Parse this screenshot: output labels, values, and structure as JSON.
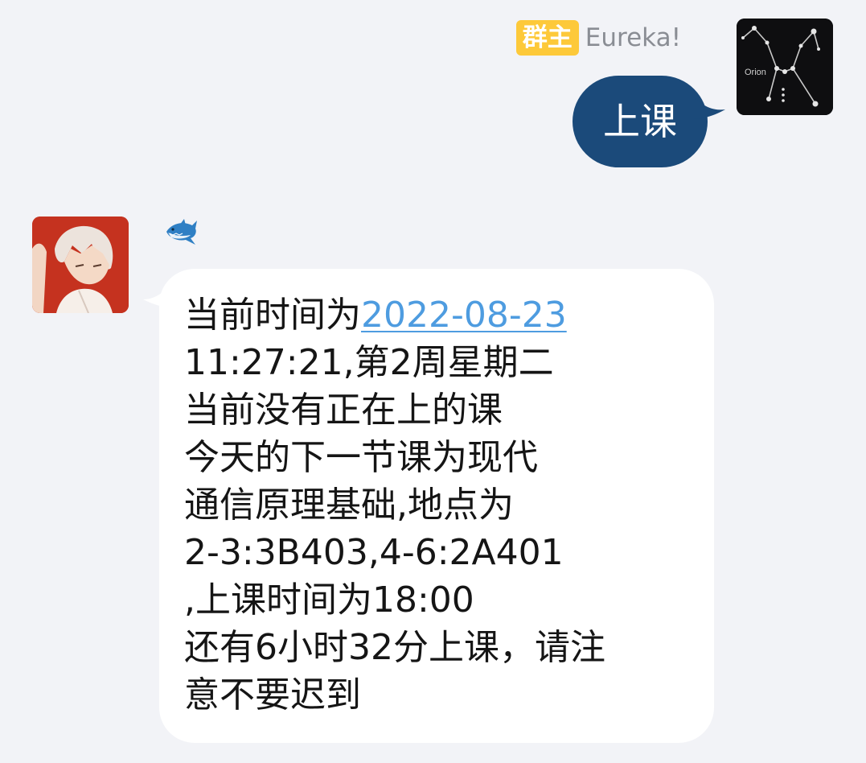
{
  "outgoing": {
    "badge": "群主",
    "sender": "Eureka!",
    "text": "上课",
    "avatar_label": "Orion",
    "bubble_color": "#1b4a7a",
    "badge_color": "#fdc93a"
  },
  "incoming": {
    "avatar": "anime-character-avatar",
    "sender_icon": "shark-icon",
    "line1_prefix": "当前时间为",
    "line1_link": "2022-08-23",
    "lines": [
      "11:27:21,第2周星期二",
      "当前没有正在上的课",
      "今天的下一节课为现代",
      "通信原理基础,地点为",
      "2-3:3B403,4-6:2A401",
      ",上课时间为18:00",
      "还有6小时32分上课，请注",
      "意不要迟到"
    ],
    "link_color": "#4e9ce0"
  }
}
